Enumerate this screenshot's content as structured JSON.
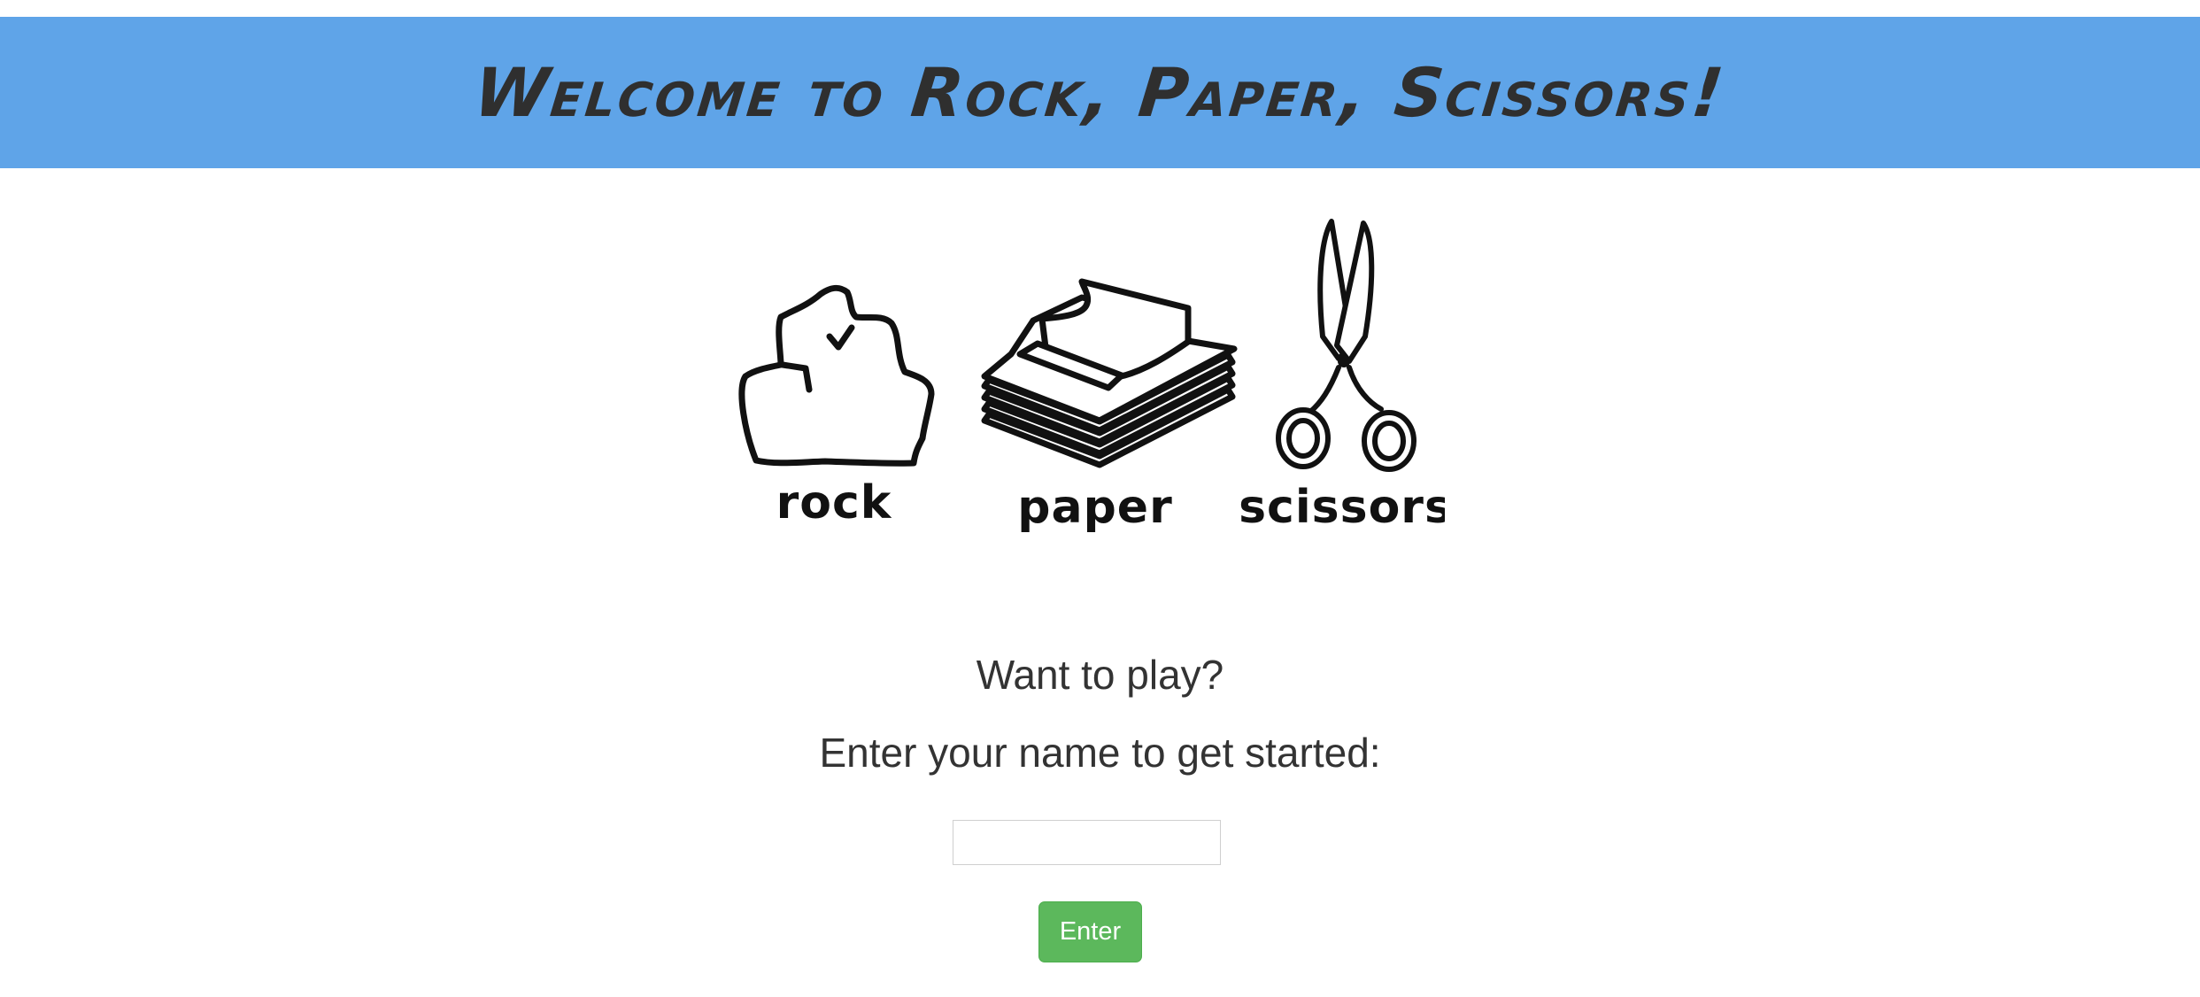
{
  "header": {
    "title": "Welcome to Rock, Paper, Scissors!",
    "background_color": "#5fa4e8"
  },
  "hero": {
    "items": [
      {
        "label": "rock",
        "icon": "rock-icon"
      },
      {
        "label": "paper",
        "icon": "paper-icon"
      },
      {
        "label": "scissors",
        "icon": "scissors-icon"
      }
    ]
  },
  "intro": {
    "question": "Want to play?",
    "instruction": "Enter your name to get started:"
  },
  "form": {
    "name_value": "",
    "name_placeholder": "",
    "submit_label": "Enter",
    "submit_color": "#5cb85c"
  }
}
